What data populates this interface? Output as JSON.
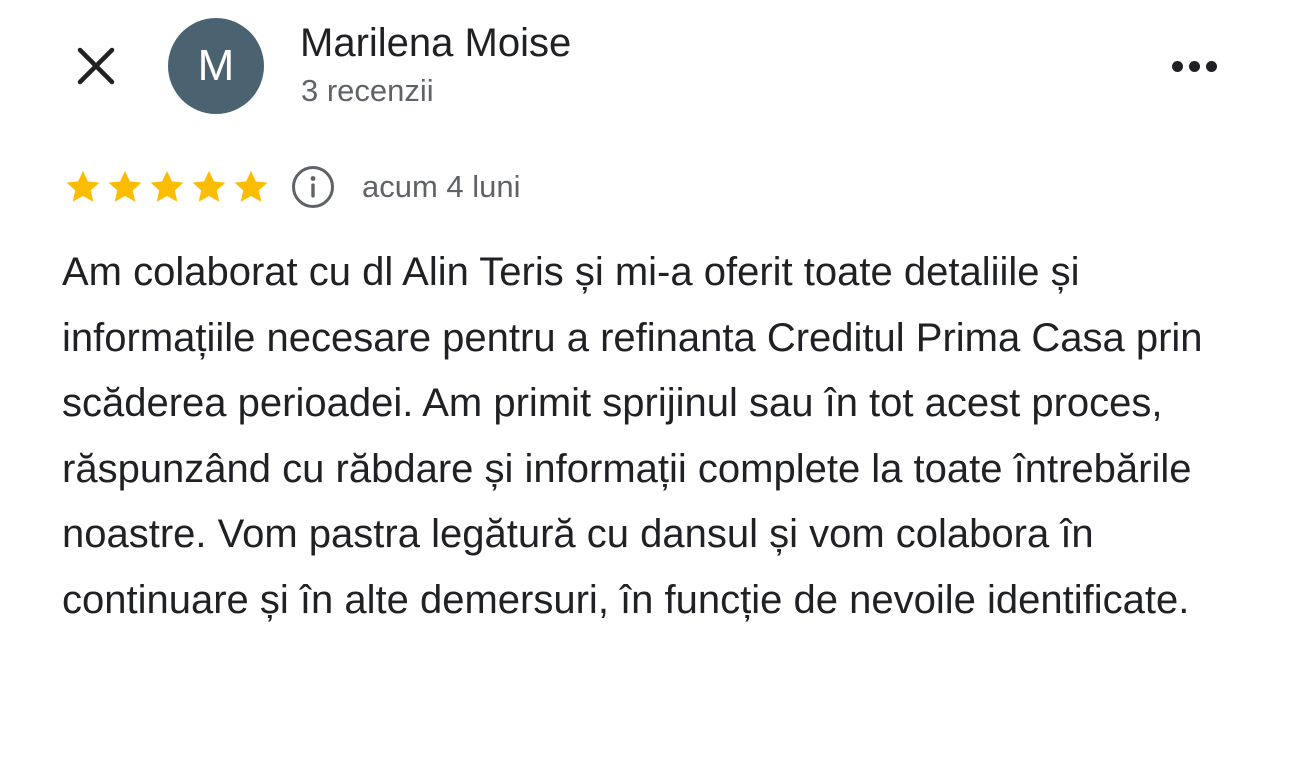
{
  "header": {
    "avatar_letter": "M",
    "author_name": "Marilena Moise",
    "review_count": "3 recenzii"
  },
  "icons": {
    "close": "close-icon",
    "more": "more-horizontal-icon",
    "star": "star-icon",
    "info": "info-icon"
  },
  "colors": {
    "avatar_bg": "#4b6370",
    "star": "#fbbc04",
    "secondary_text": "#5f6368",
    "primary_text": "#202124"
  },
  "review": {
    "rating": 5,
    "max_rating": 5,
    "time": "acum 4 luni",
    "text": "Am colaborat cu dl Alin Teris și mi-a oferit toate detaliile și informațiile necesare pentru a refinanta Creditul Prima Casa prin scăderea perioadei. Am primit sprijinul sau în tot acest proces, răspunzând cu răbdare și informații complete la toate întrebările noastre. Vom pastra legătură cu dansul și vom colabora în continuare și în alte demersuri, în funcție de nevoile identificate."
  }
}
